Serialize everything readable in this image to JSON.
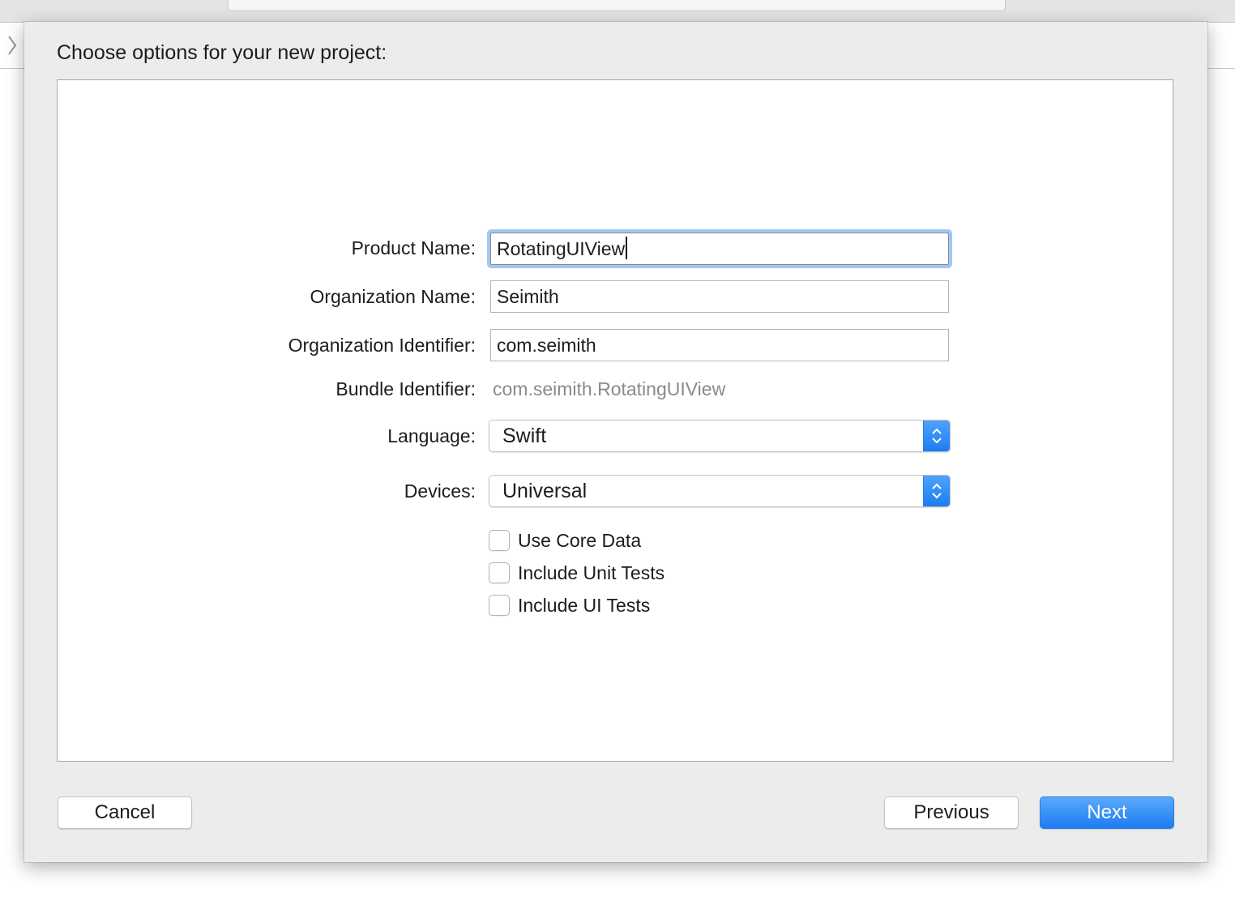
{
  "sheet": {
    "title": "Choose options for your new project:"
  },
  "form": {
    "product_name": {
      "label": "Product Name:",
      "value": "RotatingUIView"
    },
    "organization_name": {
      "label": "Organization Name:",
      "value": "Seimith"
    },
    "organization_identifier": {
      "label": "Organization Identifier:",
      "value": "com.seimith"
    },
    "bundle_identifier": {
      "label": "Bundle Identifier:",
      "value": "com.seimith.RotatingUIView"
    },
    "language": {
      "label": "Language:",
      "selected": "Swift"
    },
    "devices": {
      "label": "Devices:",
      "selected": "Universal"
    },
    "checkboxes": [
      {
        "label": "Use Core Data",
        "checked": false
      },
      {
        "label": "Include Unit Tests",
        "checked": false
      },
      {
        "label": "Include UI Tests",
        "checked": false
      }
    ]
  },
  "buttons": {
    "cancel": "Cancel",
    "previous": "Previous",
    "next": "Next"
  },
  "colors": {
    "accent": "#1d7cf2",
    "focus_ring": "#9ec8f5",
    "sheet_background": "#ececec"
  },
  "icons": {
    "popup_arrows": "up-down-chevron-icon",
    "sidebar_toggle": "chevron-right-icon"
  }
}
